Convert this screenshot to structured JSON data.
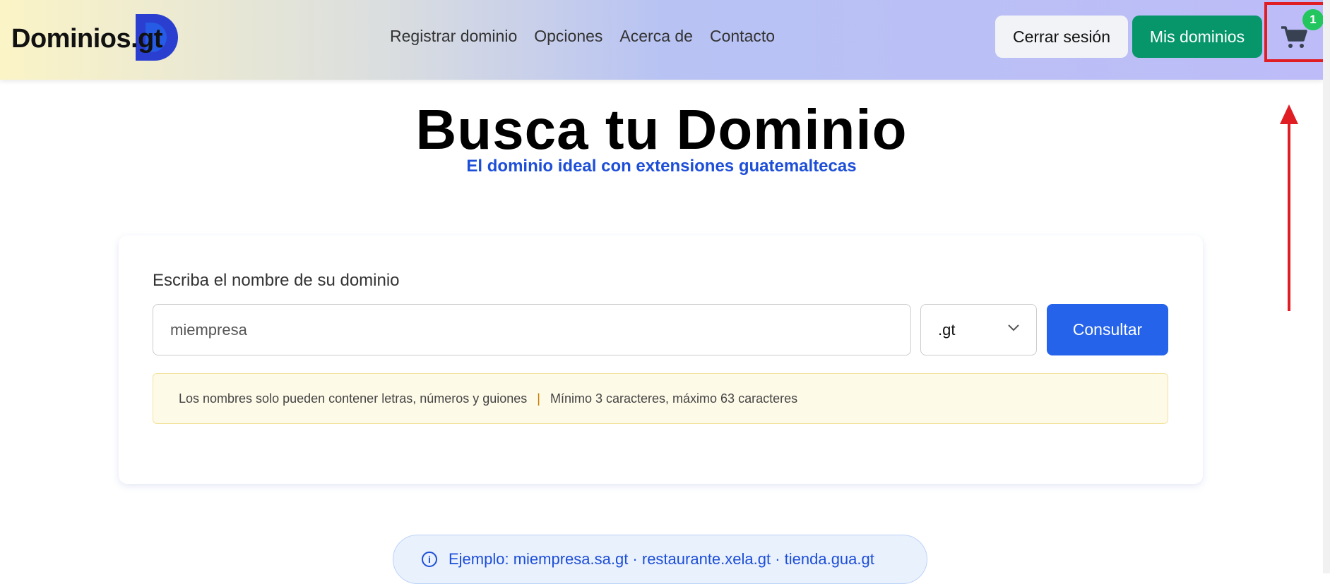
{
  "header": {
    "logo": "Dominios.gt",
    "nav": [
      "Registrar dominio",
      "Opciones",
      "Acerca de",
      "Contacto"
    ],
    "logout": "Cerrar sesión",
    "my_domains": "Mis dominios",
    "cart_count": "1",
    "highlight_color": "#e11d24"
  },
  "hero": {
    "title": "Busca tu Dominio",
    "subtitle": "El dominio ideal con extensiones guatemaltecas"
  },
  "search": {
    "label": "Escriba el nombre de su dominio",
    "placeholder": "miempresa",
    "extension": ".gt",
    "button": "Consultar",
    "rule1": "Los nombres solo pueden contener letras, números y guiones",
    "separator": "|",
    "rule2": "Mínimo 3 caracteres, máximo 63 caracteres"
  },
  "example": "Ejemplo: miempresa.sa.gt · restaurante.xela.gt · tienda.gua.gt"
}
